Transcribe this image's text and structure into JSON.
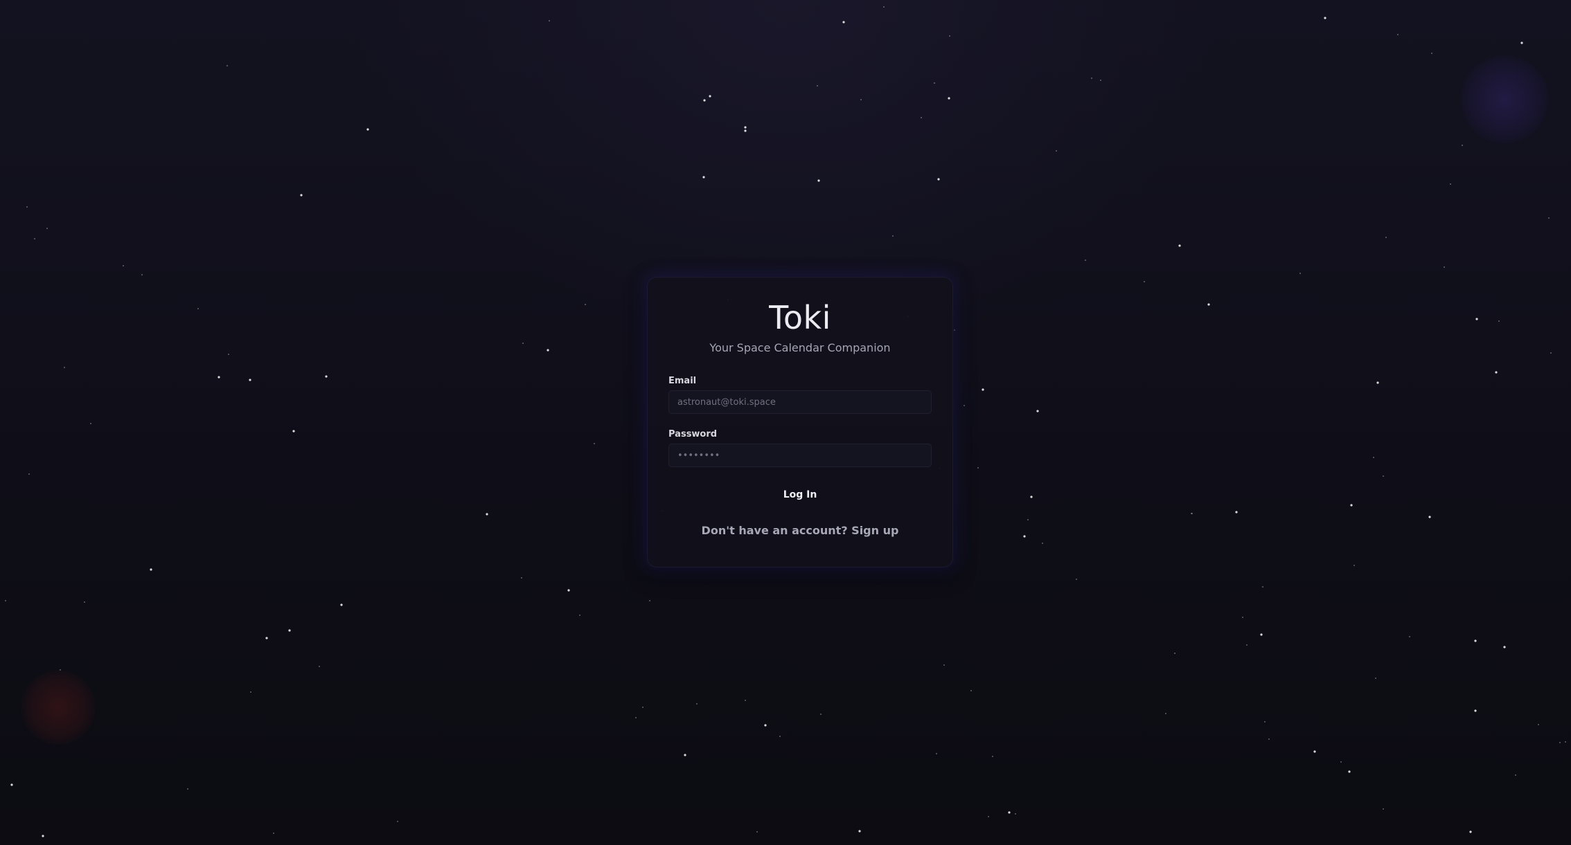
{
  "app": {
    "title": "Toki",
    "subtitle": "Your Space Calendar Companion"
  },
  "form": {
    "email": {
      "label": "Email",
      "placeholder": "astronaut@toki.space",
      "value": ""
    },
    "password": {
      "label": "Password",
      "placeholder": "••••••••",
      "value": ""
    },
    "submit_label": "Log In",
    "signup_text": "Don't have an account? Sign up"
  },
  "theme": {
    "background": "#100f18",
    "card_background": "#11101b",
    "card_glow": "#28247a",
    "text_primary": "#ecebf2",
    "text_secondary": "#a6a5b3"
  }
}
